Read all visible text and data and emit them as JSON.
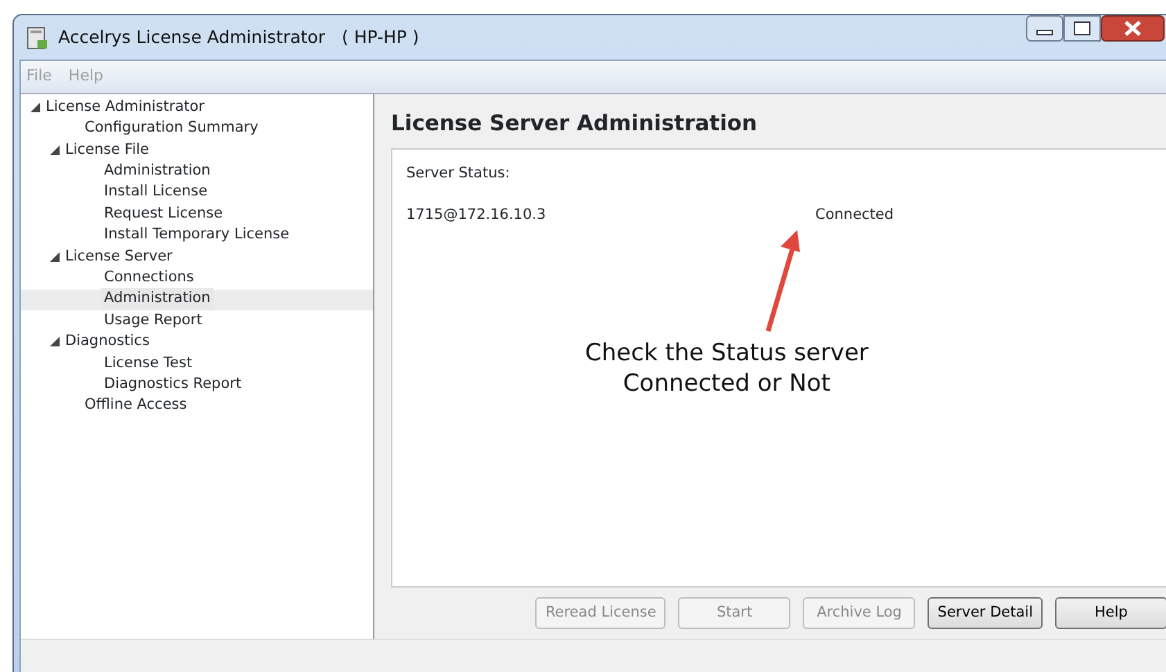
{
  "window": {
    "title": "Accelrys License Administrator   ( HP-HP )"
  },
  "menu": [
    {
      "label": "File",
      "disabled": true
    },
    {
      "label": "Help",
      "disabled": true
    }
  ],
  "tree": [
    {
      "label": "License Administrator",
      "expanded": true,
      "selected": false,
      "children": [
        {
          "label": "Configuration Summary",
          "selected": false
        },
        {
          "label": "License File",
          "expanded": true,
          "selected": false,
          "children": [
            {
              "label": "Administration",
              "selected": false
            },
            {
              "label": "Install License",
              "selected": false
            },
            {
              "label": "Request License",
              "selected": false
            },
            {
              "label": "Install Temporary License",
              "selected": false
            }
          ]
        },
        {
          "label": "License Server",
          "expanded": true,
          "selected": false,
          "children": [
            {
              "label": "Connections",
              "selected": false
            },
            {
              "label": "Administration",
              "selected": true
            },
            {
              "label": "Usage Report",
              "selected": false
            }
          ]
        },
        {
          "label": "Diagnostics",
          "expanded": true,
          "selected": false,
          "children": [
            {
              "label": "License Test",
              "selected": false
            },
            {
              "label": "Diagnostics Report",
              "selected": false
            }
          ]
        },
        {
          "label": "Offline Access",
          "selected": false
        }
      ]
    }
  ],
  "panel": {
    "title": "License Server Administration",
    "status_label": "Server Status:",
    "servers": [
      {
        "address": "1715@172.16.10.3",
        "status": "Connected"
      }
    ]
  },
  "annotation": {
    "lines": [
      "Check the Status server",
      "Connected or Not"
    ]
  },
  "buttons": [
    {
      "label": "Reread License",
      "disabled": true
    },
    {
      "label": "Start",
      "disabled": true
    },
    {
      "label": "Archive Log",
      "disabled": true
    },
    {
      "label": "Server Detail",
      "disabled": false
    },
    {
      "label": "Help",
      "disabled": false
    }
  ]
}
